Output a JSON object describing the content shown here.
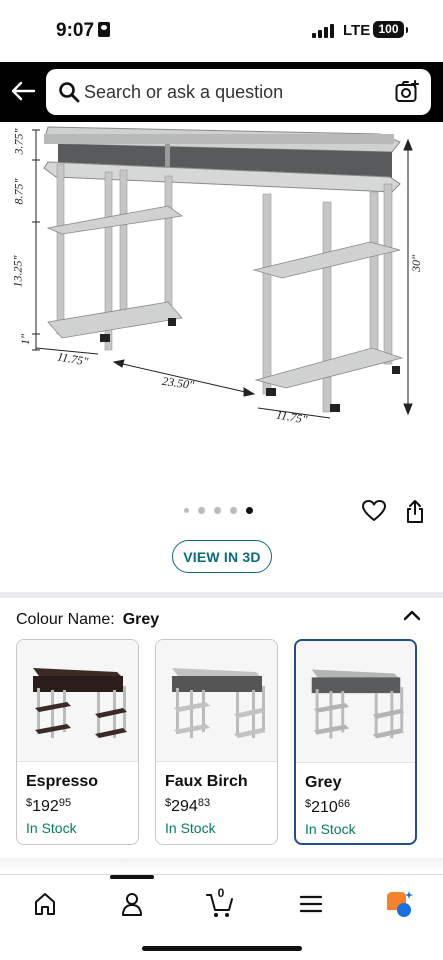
{
  "status_bar": {
    "time": "9:07",
    "network": "LTE",
    "battery": "100"
  },
  "search": {
    "placeholder": "Search or ask a question"
  },
  "product_image": {
    "dimensions": [
      "3.75\"",
      "8.75\"",
      "13.25\"",
      "1\"",
      "11.75\"",
      "23.50\"",
      "11.75\"",
      "30\""
    ]
  },
  "carousel": {
    "total": 5,
    "active_index": 4
  },
  "view_3d_label": "VIEW IN 3D",
  "colour": {
    "label": "Colour Name:",
    "value": "Grey"
  },
  "options": [
    {
      "name": "Espresso",
      "currency": "$",
      "price_whole": "192",
      "price_cents": "95",
      "stock": "In Stock",
      "color": "#3b2a26",
      "selected": false
    },
    {
      "name": "Faux Birch",
      "currency": "$",
      "price_whole": "294",
      "price_cents": "83",
      "stock": "In Stock",
      "color": "#b9b9b9",
      "selected": false
    },
    {
      "name": "Grey",
      "currency": "$",
      "price_whole": "210",
      "price_cents": "66",
      "stock": "In Stock",
      "color": "#a9abab",
      "selected": true
    }
  ],
  "tabbar": {
    "cart_count": "0",
    "items": [
      "home-icon",
      "account-icon",
      "cart-icon",
      "menu-icon",
      "rufus-icon"
    ]
  },
  "colors": {
    "accent": "#0a6c7b",
    "stock": "#067d62",
    "selected_border": "#1f4f8f"
  }
}
